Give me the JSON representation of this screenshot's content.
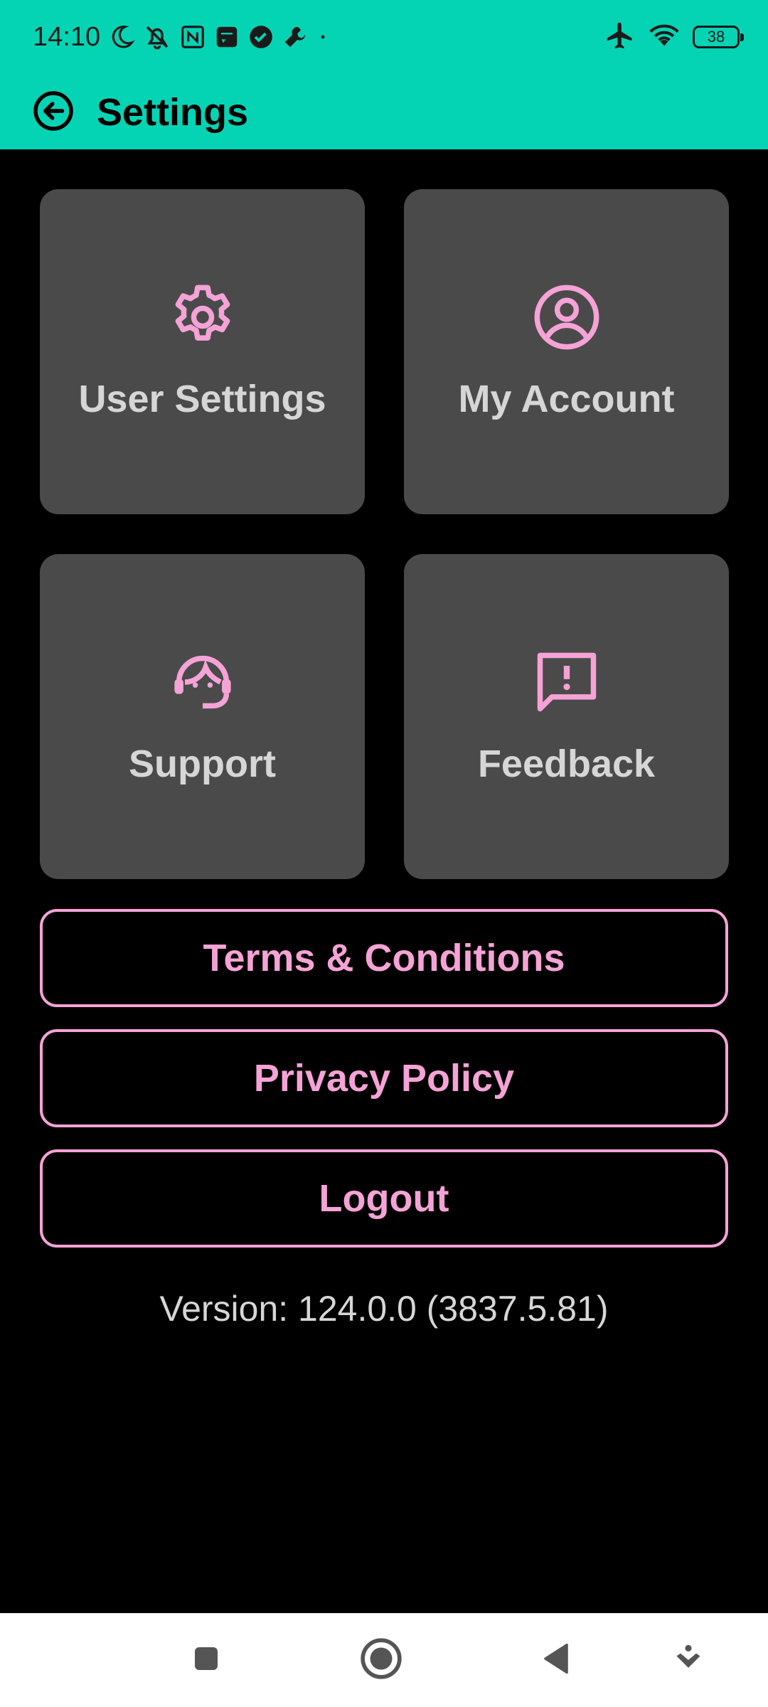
{
  "status_bar": {
    "time": "14:10",
    "battery": "38",
    "icons_left": [
      "moon-icon",
      "bell-off-icon",
      "nfc-icon",
      "mi-icon",
      "check-circle-icon",
      "wrench-icon",
      "dot-icon"
    ],
    "icons_right": [
      "airplane-icon",
      "wifi-icon",
      "battery-icon"
    ]
  },
  "app_bar": {
    "title": "Settings",
    "back_icon": "arrow-left-circle-icon"
  },
  "tiles": [
    {
      "label": "User Settings",
      "icon": "gear-icon"
    },
    {
      "label": "My Account",
      "icon": "account-circle-icon"
    },
    {
      "label": "Support",
      "icon": "support-agent-icon"
    },
    {
      "label": "Feedback",
      "icon": "feedback-icon"
    }
  ],
  "buttons": {
    "terms": "Terms & Conditions",
    "privacy": "Privacy Policy",
    "logout": "Logout"
  },
  "version": "Version: 124.0.0 (3837.5.81)",
  "nav_bar": {
    "icons": [
      "square-icon",
      "home-circle-icon",
      "back-triangle-icon",
      "keyboard-hide-icon"
    ]
  },
  "colors": {
    "header_bg": "#05D4B4",
    "tile_bg": "#4A4A4A",
    "accent_pink": "#F5A3D6",
    "tile_text": "#D6D6D6",
    "page_bg": "#000000"
  }
}
